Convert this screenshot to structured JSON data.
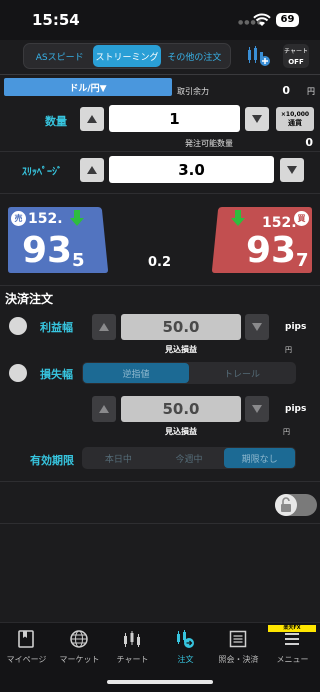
{
  "status_bar": {
    "time": "15:54",
    "battery": "69"
  },
  "mode_tabs": [
    {
      "label": "ASスピード",
      "active": false
    },
    {
      "label": "ストリーミング",
      "active": true
    },
    {
      "label": "その他の注文",
      "active": false
    }
  ],
  "chart_toggle": {
    "line1": "チャート",
    "line2": "OFF"
  },
  "order": {
    "pair_label": "ドル/円▼",
    "margin_label": "取引余力",
    "margin_value": "0",
    "margin_unit": "円",
    "quantity_label": "数量",
    "quantity_value": "1",
    "unit_line1": "×10,000",
    "unit_line2": "通貨",
    "available_label": "発注可能数量",
    "available_value": "0",
    "slippage_label": "ｽﾘｯﾍﾟｰｼﾞ",
    "slippage_value": "3.0"
  },
  "prices": {
    "sell": {
      "badge": "売",
      "big_figure": "152.",
      "pips": "93",
      "fraction": "5"
    },
    "buy": {
      "badge": "買",
      "big_figure": "152.",
      "pips": "93",
      "fraction": "7"
    },
    "spread": "0.2"
  },
  "settlement": {
    "title": "決済注文",
    "profit": {
      "label": "利益幅",
      "value": "50.0",
      "unit": "pips",
      "est_label": "見込損益",
      "est_unit": "円"
    },
    "loss": {
      "label": "損失幅",
      "segments": [
        {
          "label": "逆指値",
          "active": true
        },
        {
          "label": "トレール",
          "active": false
        }
      ],
      "value": "50.0",
      "unit": "pips",
      "est_label": "見込損益",
      "est_unit": "円"
    },
    "expiry": {
      "label": "有効期限",
      "segments": [
        {
          "label": "本日中",
          "active": false
        },
        {
          "label": "今週中",
          "active": false
        },
        {
          "label": "期限なし",
          "active": true
        }
      ]
    }
  },
  "nav": [
    {
      "label": "マイページ",
      "icon": "mypage-icon"
    },
    {
      "label": "マーケット",
      "icon": "market-icon"
    },
    {
      "label": "チャート",
      "icon": "chart-icon"
    },
    {
      "label": "注文",
      "icon": "order-icon",
      "active": true
    },
    {
      "label": "照会・決済",
      "icon": "inquiry-icon"
    },
    {
      "label": "メニュー",
      "icon": "menu-icon"
    }
  ],
  "brand_badge": "楽天FX",
  "colors": {
    "accent": "#37c5df",
    "sell": "#5274c0",
    "buy": "#c24f50",
    "tab_active": "#2a9fd6"
  }
}
